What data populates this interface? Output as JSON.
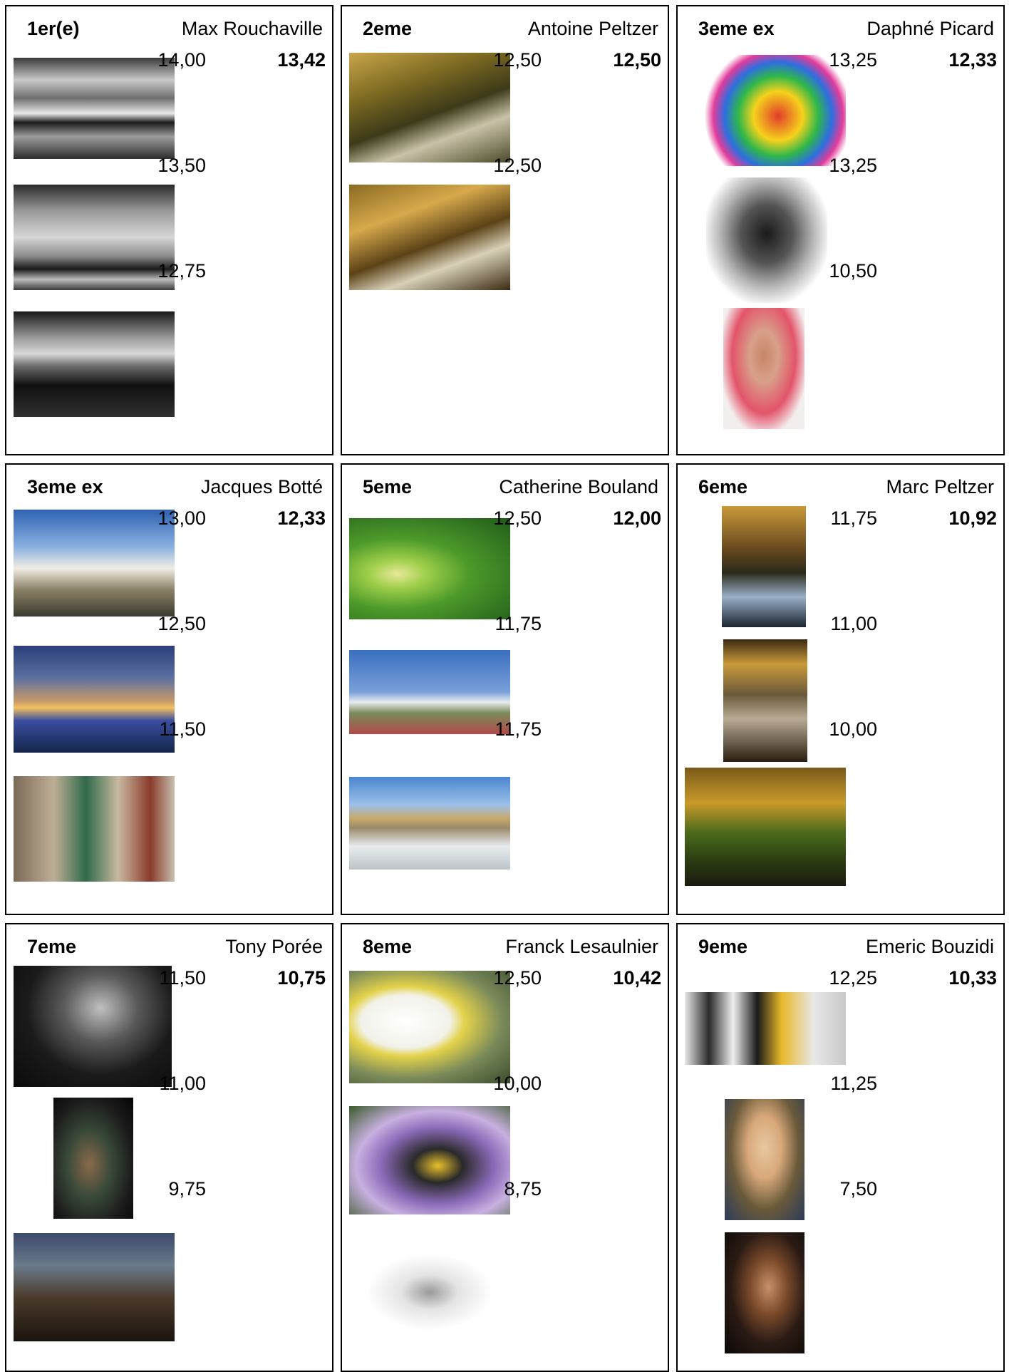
{
  "entries": [
    {
      "rank": "1er(e)",
      "name": "Max Rouchaville",
      "average": "13,42",
      "photos": [
        {
          "score": "14,00",
          "subject": "cloudy-lake-bw-photo",
          "bg": "linear-gradient(180deg,#3a3a3a 0%,#c9c9c9 22%,#6e6e6e 40%,#e8e8e8 55%,#1b1b1b 64%,#9c9c9c 78%,#2c2c2c 100%)"
        },
        {
          "score": "13,50",
          "subject": "mountain-clouds-bw-photo",
          "bg": "linear-gradient(180deg,#2a2a2a 0%,#9a9a9a 25%,#d6d6d6 50%,#8a8a8a 68%,#1a1a1a 80%,#bcbcbc 90%,#3a3a3a 100%)"
        },
        {
          "score": "12,75",
          "subject": "harbor-boat-bw-photo",
          "bg": "linear-gradient(180deg,#1a1a1a 0%,#9a9a9a 25%,#d9d9d9 40%,#6a6a6a 52%,#101010 70%,#303030 100%)"
        }
      ]
    },
    {
      "rank": "2eme",
      "name": "Antoine Peltzer",
      "average": "12,50",
      "photos": [
        {
          "score": "12,50",
          "subject": "autumn-forest-stream-photo",
          "bg": "linear-gradient(160deg,#c9a64a 0%,#7d6a22 30%,#3c3a18 55%,#c8c2a8 72%,#4c4a2a 100%)"
        },
        {
          "score": "12,50",
          "subject": "autumn-river-trees-photo",
          "bg": "linear-gradient(160deg,#8a6a22 0%,#d7a94c 30%,#5b4216 55%,#d8d0b8 72%,#3b2a12 100%)"
        }
      ]
    },
    {
      "rank": "3eme ex",
      "name": "Daphné Picard",
      "average": "12,33",
      "photos": [
        {
          "score": "13,25",
          "subject": "lips-lollipop-photo",
          "bg": "radial-gradient(circle at 58% 55%,#e23c2a 0%,#f5d21c 22%,#2fb74a 36%,#2d6fe0 48%,#e23c9a 58%,#ffffff 66%)"
        },
        {
          "score": "13,25",
          "subject": "woman-portrait-bw-photo",
          "bg": "radial-gradient(ellipse at 50% 45%,#1a1a1a 0%,#545454 30%,#b9b9b9 55%,#ffffff 75%)"
        },
        {
          "score": "10,50",
          "subject": "woman-pink-dress-photo",
          "bg": "radial-gradient(ellipse at 50% 40%,#c88566 0%,#d8a08a 25%,#e3546a 55%,#f3eeee 78%)"
        }
      ]
    },
    {
      "rank": "3eme ex",
      "name": "Jacques Botté",
      "average": "12,33",
      "photos": [
        {
          "score": "13,00",
          "subject": "modern-villa-photo",
          "bg": "linear-gradient(180deg,#2e62b2 0%,#8ab0e0 35%,#f0ede4 55%,#8a8066 75%,#3a3a2e 100%)"
        },
        {
          "score": "12,50",
          "subject": "bridge-city-dusk-photo",
          "bg": "linear-gradient(180deg,#2a3f7a 0%,#5c6fa0 30%,#c89a6a 52%,#f2c060 58%,#3a4ea0 70%,#14244a 100%)"
        },
        {
          "score": "11,50",
          "subject": "village-shop-street-photo",
          "bg": "linear-gradient(90deg,#7a6a56 0%,#bfae96 25%,#2f6a4a 45%,#c9b9a0 65%,#8a3a2a 85%,#c8c0b0 100%)"
        }
      ]
    },
    {
      "rank": "5eme",
      "name": "Catherine Bouland",
      "average": "12,00",
      "photos": [
        {
          "score": "12,50",
          "subject": "green-caterpillar-photo",
          "bg": "radial-gradient(ellipse at 30% 55%,#e8e89a 0%,#9fcf4a 18%,#4d9a2a 45%,#1f5a1a 100%)"
        },
        {
          "score": "11,75",
          "subject": "seagulls-photo",
          "bg": "linear-gradient(180deg,#3a6fc0 0%,#7aa0d8 50%,#e8ecf0 62%,#7a8a5a 75%,#b04a4a 100%)"
        },
        {
          "score": "11,75",
          "subject": "versailles-swans-photo",
          "bg": "linear-gradient(180deg,#4a86d0 0%,#9cc0ea 30%,#c8a86a 45%,#9a8a6a 55%,#e8ecef 75%,#bcc4c8 100%)"
        }
      ]
    },
    {
      "rank": "6eme",
      "name": "Marc Peltzer",
      "average": "10,92",
      "photos": [
        {
          "score": "11,75",
          "subject": "forest-waterfall-photo",
          "bg": "linear-gradient(180deg,#c99a3a 0%,#6a4a1e 35%,#2a2a1a 55%,#9ab0c8 75%,#1a2430 100%)"
        },
        {
          "score": "11,00",
          "subject": "cascade-rocks-photo",
          "bg": "linear-gradient(180deg,#3a2a12 0%,#c99a3a 20%,#6a5a3a 45%,#b8aa94 65%,#2a1e10 100%)"
        },
        {
          "score": "10,00",
          "subject": "mossy-rocks-forest-photo",
          "bg": "linear-gradient(180deg,#7a5a1a 0%,#c99a2a 30%,#4a6a1a 55%,#2a3a12 80%,#1a1a0e 100%)"
        }
      ]
    },
    {
      "rank": "7eme",
      "name": "Tony Porée",
      "average": "10,75",
      "photos": [
        {
          "score": "11,50",
          "subject": "guitarist-bw-photo",
          "bg": "radial-gradient(ellipse at 55% 35%,#c0c0c0 0%,#5a5a5a 30%,#1a1a1a 60%,#0a0a0a 100%)"
        },
        {
          "score": "11,00",
          "subject": "guitarist-night-photo",
          "bg": "radial-gradient(ellipse at 45% 55%,#8a6a4a 0%,#3a4a3a 35%,#1a1a1a 70%,#050505 100%)"
        },
        {
          "score": "9,75",
          "subject": "guitarist-outdoor-dusk-photo",
          "bg": "linear-gradient(180deg,#3a4a6a 0%,#6a7a8a 30%,#4a3a2a 60%,#1a140e 100%)"
        }
      ]
    },
    {
      "rank": "8eme",
      "name": "Franck Lesaulnier",
      "average": "10,42",
      "photos": [
        {
          "score": "12,50",
          "subject": "white-flowers-fly-photo",
          "bg": "radial-gradient(ellipse at 35% 45%,#ffffff 0%,#f2f2ea 30%,#e3d24a 40%,#7a8a5a 65%,#3a4a2a 100%)"
        },
        {
          "score": "10,00",
          "subject": "bumblebee-lavender-photo",
          "bg": "radial-gradient(ellipse at 55% 55%,#e8c02a 0%,#2a2a2a 20%,#8a6ab8 45%,#c8b0e0 65%,#3a5a2a 100%)"
        },
        {
          "score": "8,75",
          "subject": "lizard-bw-photo",
          "bg": "radial-gradient(ellipse at 50% 50%,#9a9a9a 0%,#e4e4e4 25%,#ffffff 55%)"
        }
      ]
    },
    {
      "rank": "9eme",
      "name": "Emeric Bouzidi",
      "average": "10,33",
      "photos": [
        {
          "score": "12,25",
          "subject": "ice-hockey-photo",
          "bg": "linear-gradient(90deg,#e8e8e8 0%,#2a2a2a 15%,#f0f0f0 30%,#1a1a1a 45%,#e8b82a 60%,#e8e8e8 80%,#c8c8c8 100%)"
        },
        {
          "score": "11,25",
          "subject": "child-portrait-photo",
          "bg": "radial-gradient(ellipse at 50% 40%,#e8c8a0 0%,#d8a87a 30%,#6a5a3a 60%,#2a3a5a 100%)"
        },
        {
          "score": "7,50",
          "subject": "man-portrait-night-photo",
          "bg": "radial-gradient(ellipse at 55% 45%,#c8906a 0%,#7a4a2a 30%,#2a1a14 60%,#0a0806 100%)"
        }
      ]
    }
  ]
}
